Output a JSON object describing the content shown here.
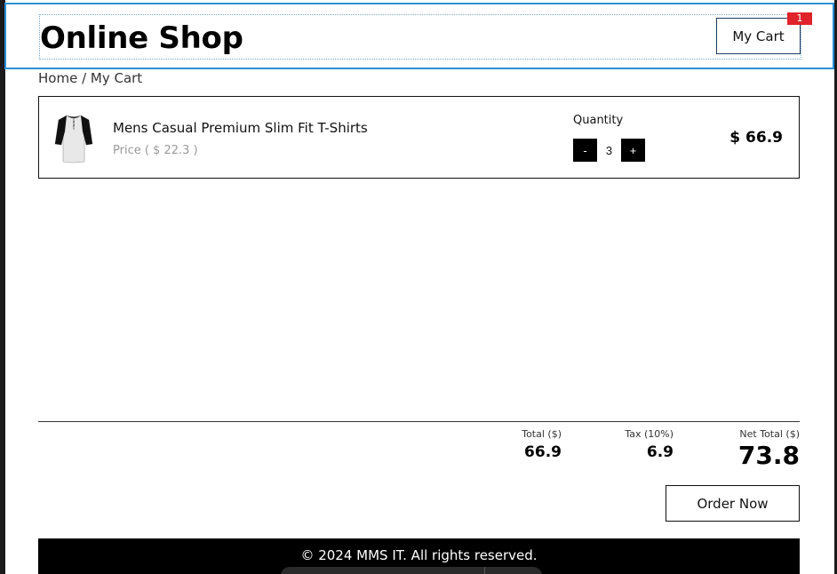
{
  "header": {
    "title": "Online Shop",
    "cart_label": "My Cart",
    "cart_count": "1"
  },
  "breadcrumb": {
    "home": "Home",
    "separator": " / ",
    "current": "My Cart"
  },
  "cart": {
    "items": [
      {
        "name": "Mens Casual Premium Slim Fit T-Shirts",
        "price": "Price ( $ 22.3 )",
        "quantity_label": "Quantity",
        "quantity": "3",
        "minus_label": "-",
        "plus_label": "+",
        "line_total": "$ 66.9",
        "image_icon": "tshirt-image"
      }
    ]
  },
  "summary": {
    "total_label": "Total ($)",
    "total_value": "66.9",
    "tax_label": "Tax (10%)",
    "tax_value": "6.9",
    "net_label": "Net Total ($)",
    "net_value": "73.8"
  },
  "actions": {
    "order_label": "Order Now"
  },
  "footer": {
    "copyright": "© 2024 MMS IT. All rights reserved."
  },
  "colors": {
    "accent_border": "#2d8fd6",
    "badge": "#e0232b",
    "footer_bg": "#000000"
  }
}
